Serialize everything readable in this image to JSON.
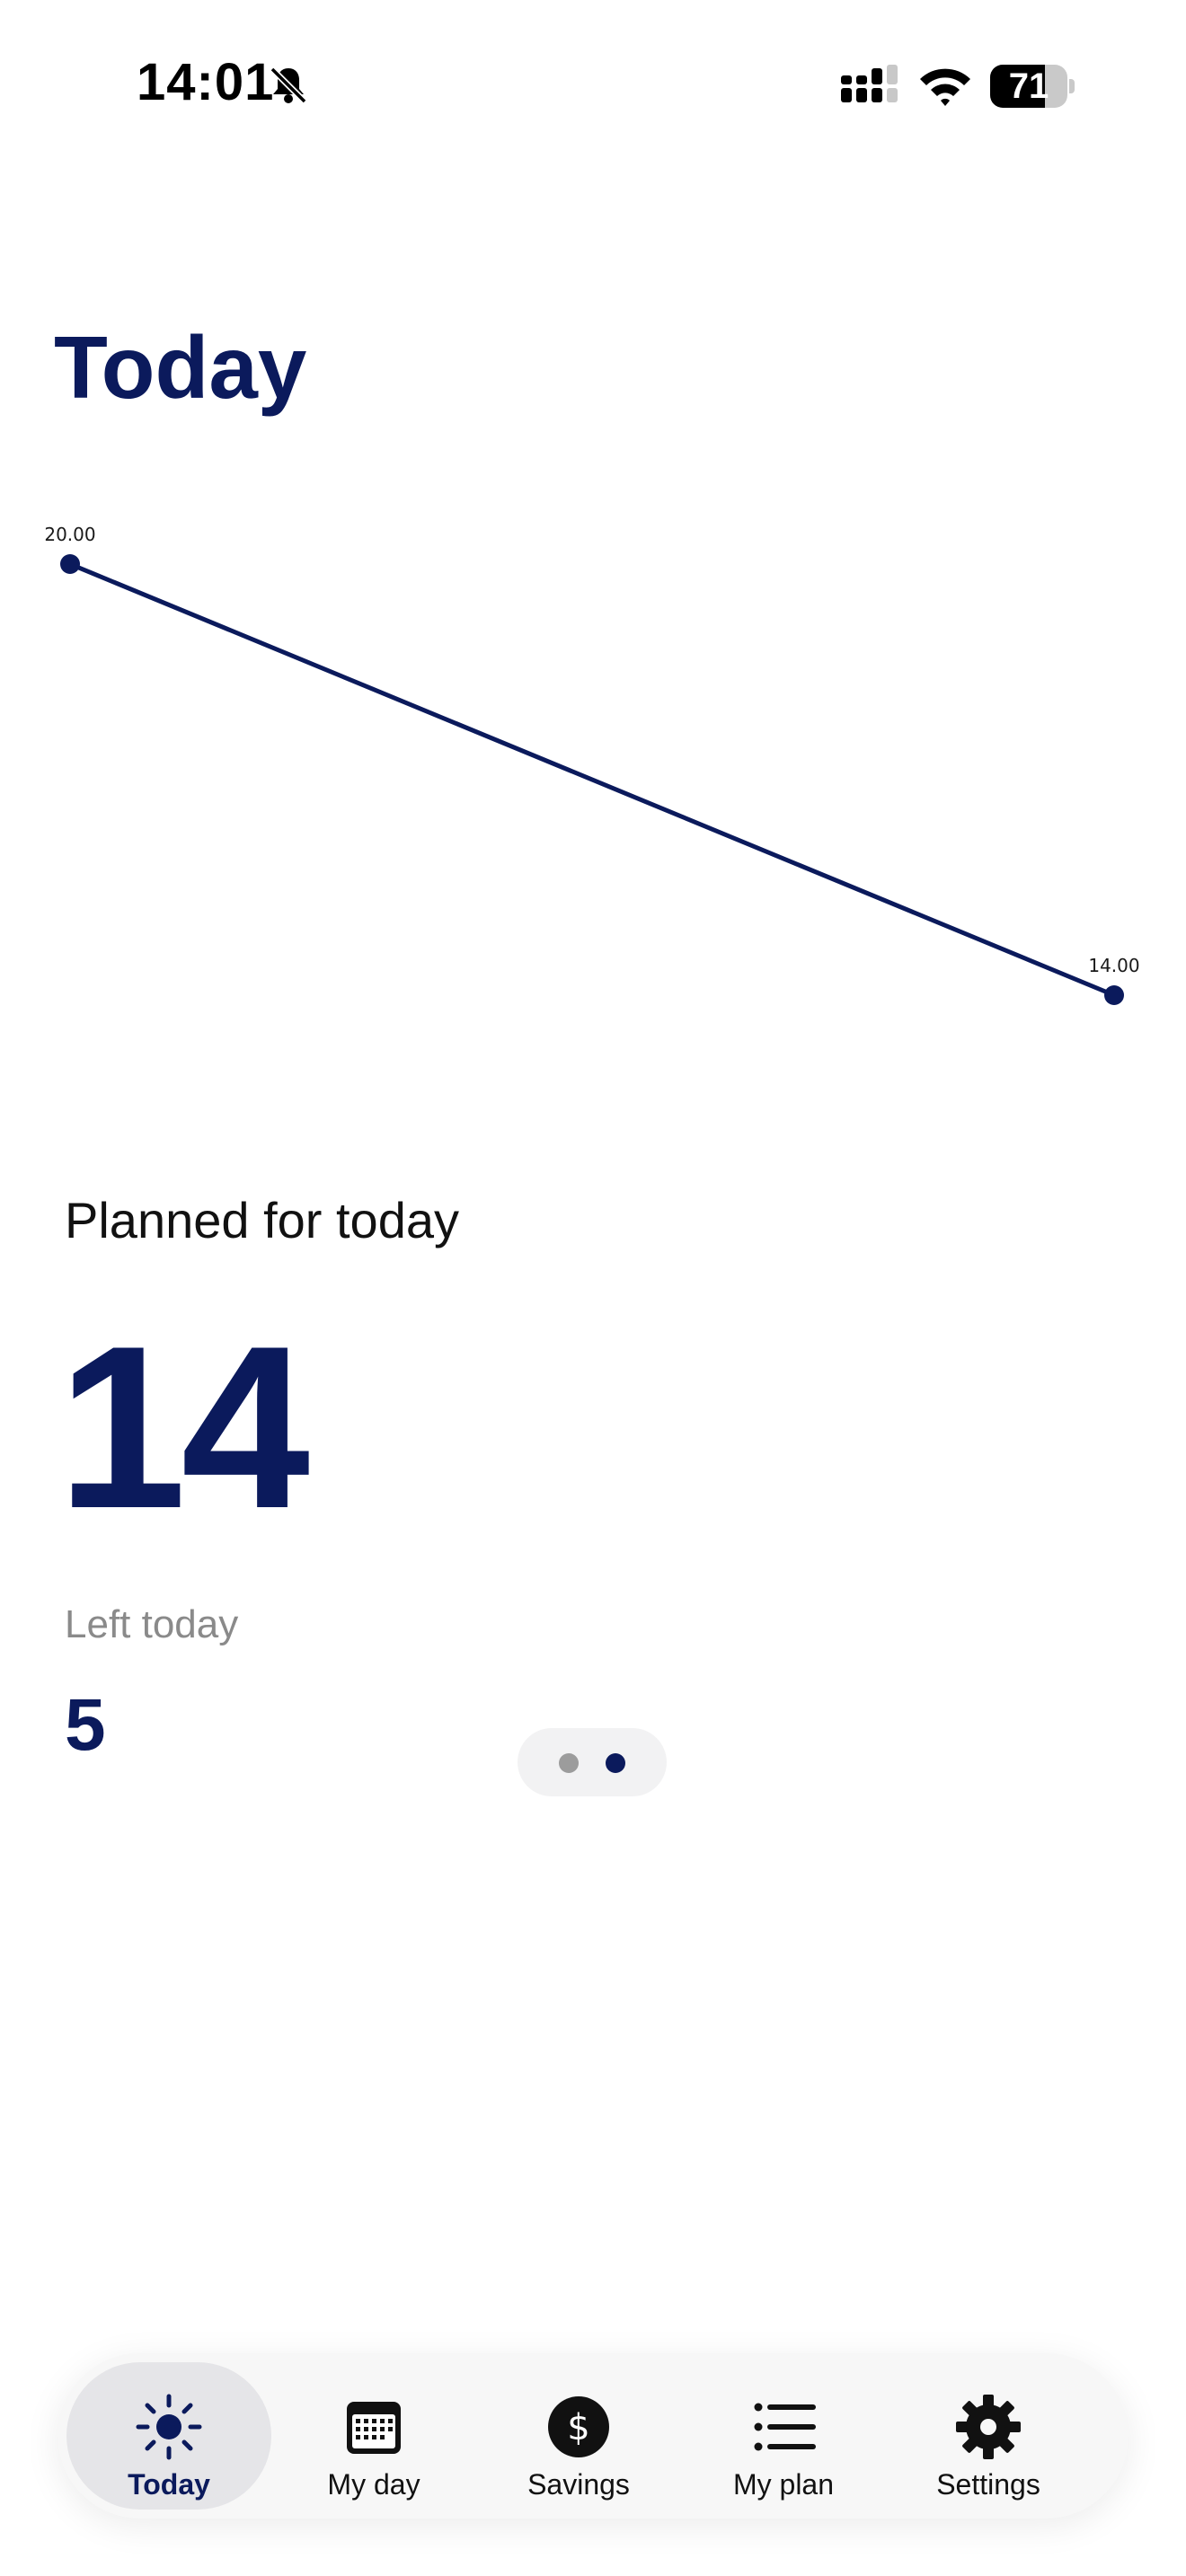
{
  "status_bar": {
    "time": "14:01",
    "battery_level": "71",
    "battery_fraction": 0.71
  },
  "header": {
    "title": "Today"
  },
  "chart_data": {
    "type": "line",
    "title": "",
    "xlabel": "",
    "ylabel": "",
    "grid": false,
    "color": "#0b1a5c",
    "points": [
      {
        "label": "20.00",
        "y": 20
      },
      {
        "label": "14.00",
        "y": 14
      }
    ]
  },
  "summary": {
    "planned_label": "Planned for today",
    "planned_value": "14",
    "left_label": "Left today",
    "left_value": "5"
  },
  "pager": {
    "pages": 2,
    "current": 2
  },
  "tab_bar": {
    "tabs": [
      {
        "label": "Today",
        "icon": "sun-icon",
        "active": true
      },
      {
        "label": "My day",
        "icon": "calendar-icon",
        "active": false
      },
      {
        "label": "Savings",
        "icon": "dollar-icon",
        "active": false
      },
      {
        "label": "My plan",
        "icon": "list-icon",
        "active": false
      },
      {
        "label": "Settings",
        "icon": "gear-icon",
        "active": false
      }
    ]
  },
  "colors": {
    "accent": "#0b1a5c",
    "muted_text": "#8a8a8a",
    "tab_bar_bg": "#f7f7f7",
    "tab_active_bg": "#e5e5e8"
  }
}
